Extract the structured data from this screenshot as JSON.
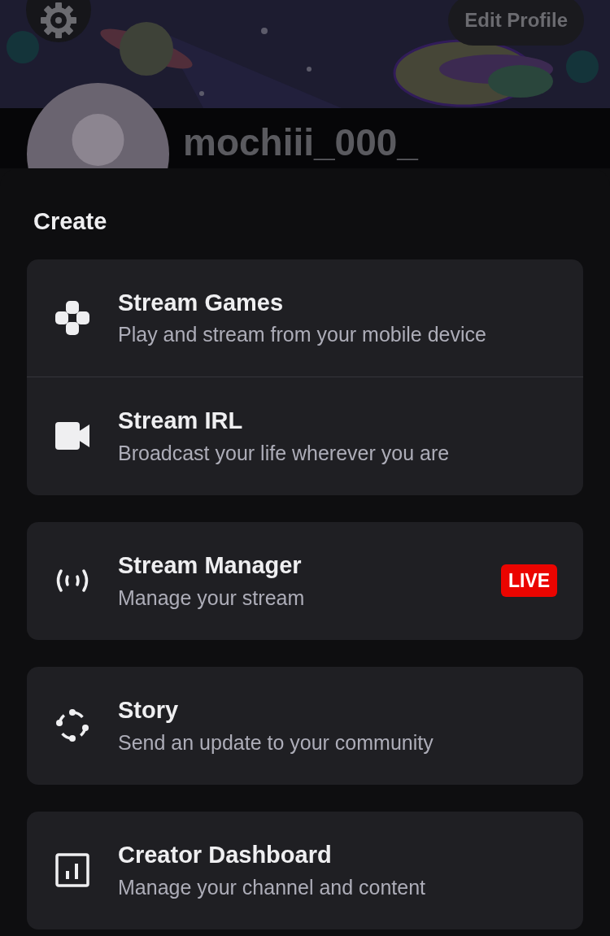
{
  "header": {
    "edit_button": "Edit Profile",
    "username": "mochiii_000_"
  },
  "sheet": {
    "title": "Create",
    "groups": [
      {
        "items": [
          {
            "kind": "gamepad",
            "title": "Stream Games",
            "subtitle": "Play and stream from your mobile device"
          },
          {
            "kind": "camera",
            "title": "Stream IRL",
            "subtitle": "Broadcast your life wherever you are"
          }
        ]
      },
      {
        "items": [
          {
            "kind": "broadcast",
            "title": "Stream Manager",
            "subtitle": "Manage your stream",
            "badge": "LIVE"
          }
        ]
      },
      {
        "items": [
          {
            "kind": "story",
            "title": "Story",
            "subtitle": "Send an update to your community"
          }
        ]
      },
      {
        "items": [
          {
            "kind": "dashboard",
            "title": "Creator Dashboard",
            "subtitle": "Manage your channel and content"
          }
        ]
      }
    ]
  }
}
